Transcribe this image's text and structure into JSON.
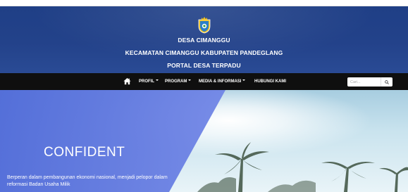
{
  "header": {
    "line1": "DESA CIMANGGU",
    "line2": "KECAMATAN CIMANGGU KABUPATEN PANDEGLANG",
    "line3": "PORTAL DESA TERPADU",
    "logo_icon": "regency-crest-icon"
  },
  "nav": {
    "home_icon": "home-icon",
    "items": [
      {
        "label": "PROFIL",
        "dropdown": true
      },
      {
        "label": "PROGRAM",
        "dropdown": true
      },
      {
        "label": "MEDIA & INFORMASI",
        "dropdown": true
      },
      {
        "label": "HUBUNGI KAMI",
        "dropdown": false
      }
    ],
    "search_placeholder": "Cari...",
    "search_icon": "search-icon"
  },
  "hero": {
    "title": "CONFIDENT",
    "description": "Berperan dalam pembangunan ekonomi nasional, menjadi pelopor dalam reformasi Badan Usaha Milik"
  },
  "colors": {
    "header_bg": "#23428a",
    "navbar_bg": "#0f0f0f",
    "overlay": "#5b72e0"
  }
}
